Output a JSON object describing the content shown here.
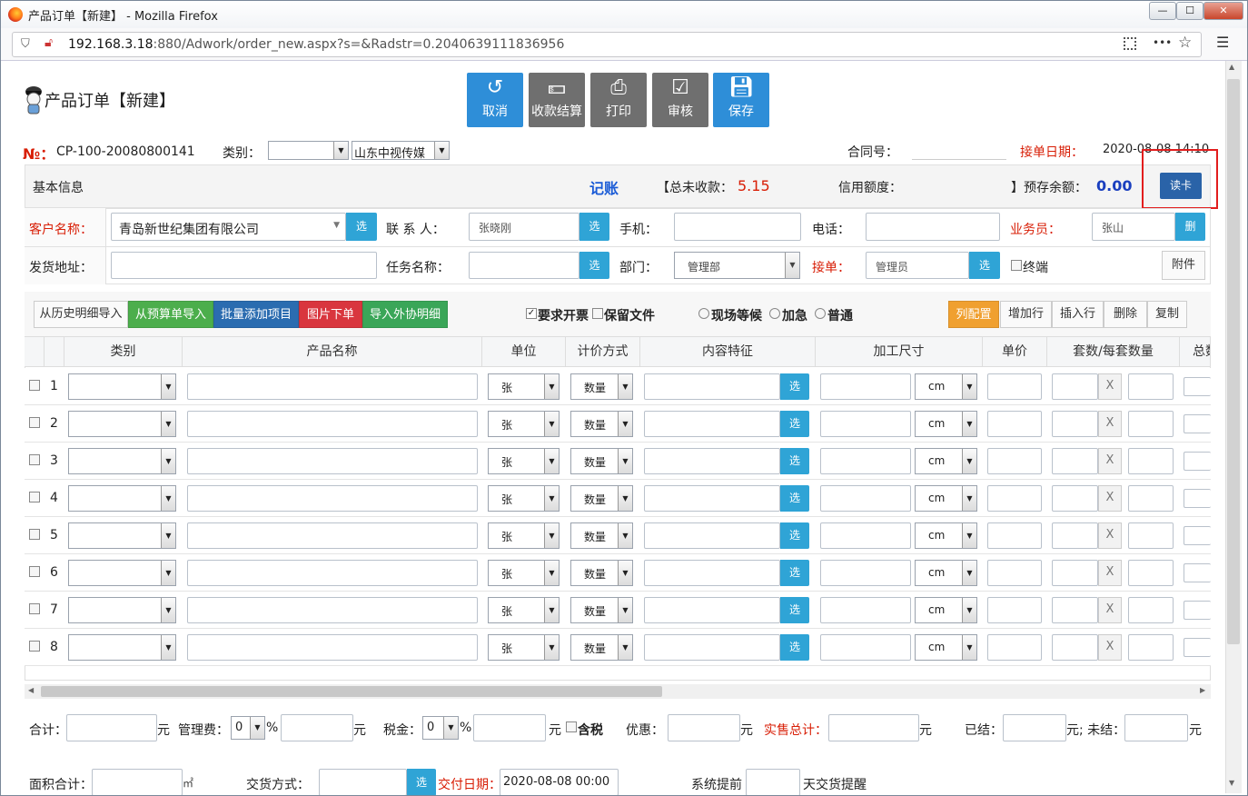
{
  "browser": {
    "title": "产品订单【新建】 - Mozilla Firefox",
    "url_host": "192.168.3.18",
    "url_rest": ":880/Adwork/order_new.aspx?s=&Radstr=0.2040639111836956",
    "min": "—",
    "max": "☐",
    "close": "✕",
    "menu_dots": "•••",
    "star": "☆",
    "hamburger": "☰"
  },
  "page": {
    "title": "产品订单【新建】"
  },
  "toolbar": {
    "cancel": "取消",
    "settle": "收款结算",
    "print": "打印",
    "audit": "审核",
    "save": "保存"
  },
  "order": {
    "no_label": "№：",
    "no": "CP-100-20080800141",
    "category_label": "类别：",
    "category": "",
    "company": "山东中视传媒",
    "contract_label": "合同号：",
    "contract": "",
    "date_label": "接单日期：",
    "date": "2020-08-08 14:10"
  },
  "basic": {
    "label": "基本信息",
    "bookkeep": "记账",
    "unpaid_label": "【总未收款：",
    "unpaid": "5.15",
    "credit_label": "信用额度：",
    "credit": "",
    "prestore_label": "】预存余额：",
    "prestore": "0.00",
    "readcard": "读卡"
  },
  "form": {
    "customer_label": "客户名称：",
    "customer": "青岛新世纪集团有限公司",
    "pick": "选",
    "contact_label": "联 系 人：",
    "contact": "张晓刚",
    "mobile_label": "手机：",
    "mobile": "",
    "phone_label": "电话：",
    "phone": "",
    "sales_label": "业务员：",
    "sales": "张山",
    "del": "删",
    "address_label": "发货地址：",
    "address": "",
    "task_label": "任务名称：",
    "task": "",
    "dept_label": "部门：",
    "dept": "管理部",
    "receiver_label": "接单：",
    "receiver": "管理员",
    "terminal": "终端",
    "attach": "附件"
  },
  "actions": {
    "history": "从历史明细导入",
    "budget": "从预算单导入",
    "batch": "批量添加项目",
    "image": "图片下单",
    "outsource": "导入外协明细",
    "invoice": "要求开票",
    "keepfile": "保留文件",
    "onsite": "现场等候",
    "urgent": "加急",
    "normal": "普通",
    "colcfg": "列配置",
    "addrow": "增加行",
    "insrow": "插入行",
    "delrow": "删除",
    "copy": "复制"
  },
  "table": {
    "headers": [
      "类别",
      "产品名称",
      "单位",
      "计价方式",
      "内容特征",
      "加工尺寸",
      "单价",
      "套数/每套数量",
      "总数"
    ],
    "rows": [
      {
        "n": "1",
        "unit": "张",
        "price": "数量",
        "size_unit": "cm",
        "x": "X"
      },
      {
        "n": "2",
        "unit": "张",
        "price": "数量",
        "size_unit": "cm",
        "x": "X"
      },
      {
        "n": "3",
        "unit": "张",
        "price": "数量",
        "size_unit": "cm",
        "x": "X"
      },
      {
        "n": "4",
        "unit": "张",
        "price": "数量",
        "size_unit": "cm",
        "x": "X"
      },
      {
        "n": "5",
        "unit": "张",
        "price": "数量",
        "size_unit": "cm",
        "x": "X"
      },
      {
        "n": "6",
        "unit": "张",
        "price": "数量",
        "size_unit": "cm",
        "x": "X"
      },
      {
        "n": "7",
        "unit": "张",
        "price": "数量",
        "size_unit": "cm",
        "x": "X"
      },
      {
        "n": "8",
        "unit": "张",
        "price": "数量",
        "size_unit": "cm",
        "x": "X"
      }
    ]
  },
  "footer": {
    "total_label": "合计：",
    "yuan": "元",
    "mgmt_label": "管理费：",
    "mgmt_pct": "0",
    "pct": "%",
    "tax_label": "税金：",
    "tax_pct": "0",
    "tax_incl": "含税",
    "discount_label": "优惠：",
    "sales_total_label": "实售总计：",
    "paid_label": "已结：",
    "unpaid_label": "元; 未结：",
    "area_label": "面积合计：",
    "sqm": "㎡",
    "delivery_label": "交货方式：",
    "due_label": "交付日期：",
    "due": "2020-08-08 00:00",
    "remind_label": "系统提前",
    "remind_suffix": "天交货提醒"
  },
  "colors": {
    "accent": "#2e8ed8",
    "red": "#d81e06",
    "orange": "#f0a030",
    "green": "#4cae4c",
    "darkblue": "#2a63a8"
  }
}
